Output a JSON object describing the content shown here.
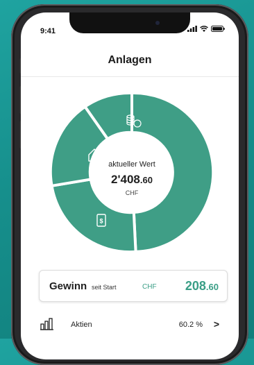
{
  "status_bar": {
    "time": "9:41"
  },
  "header": {
    "title": "Anlagen"
  },
  "donut": {
    "center_label": "aktueller Wert",
    "value_main": "2'408",
    "value_cents": ".60",
    "currency": "CHF",
    "segment_color": "#3f9e86",
    "segments": [
      {
        "icon": "chart-bars-icon"
      },
      {
        "icon": "cash-note-icon"
      },
      {
        "icon": "house-icon"
      },
      {
        "icon": "coins-stack-icon"
      }
    ]
  },
  "gain_card": {
    "label": "Gewinn",
    "sublabel": "seit Start",
    "currency": "CHF",
    "value_main": "208",
    "value_cents": ".60"
  },
  "list": [
    {
      "label": "Aktien",
      "percent": "60.2 %",
      "icon": "chart-bars-icon"
    }
  ],
  "colors": {
    "accent": "#3a9e86",
    "background": "#1a9693"
  }
}
